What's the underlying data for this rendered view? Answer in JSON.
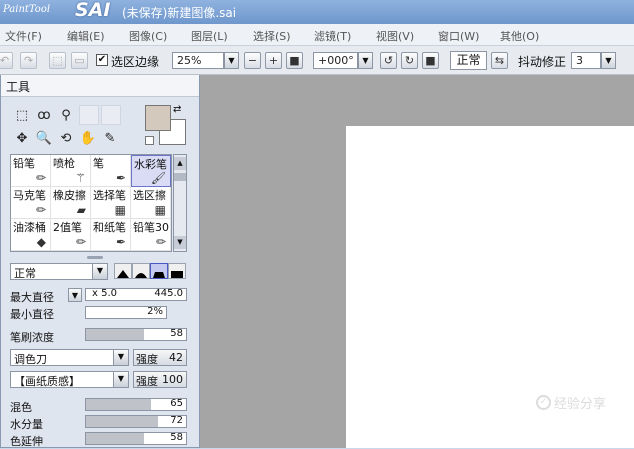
{
  "app": {
    "logo_small": "PaintTool",
    "logo_big": "SAI",
    "title": "(未保存)新建图像.sai"
  },
  "menu": [
    "文件(F)",
    "编辑(E)",
    "图像(C)",
    "图层(L)",
    "选择(S)",
    "滤镜(T)",
    "视图(V)",
    "窗口(W)",
    "其他(O)"
  ],
  "toolbar": {
    "selection_edge_checked": true,
    "selection_edge_label": "选区边缘",
    "zoom_value": "25%",
    "zoom_out": "−",
    "zoom_in": "+",
    "zoom_reset": "■",
    "rotation_value": "+000°",
    "blend_mode": "正常",
    "stabilizer_label": "抖动修正",
    "stabilizer_value": "3"
  },
  "panel": {
    "title": "工具",
    "tools_row1": [
      "⬚",
      "ꝏ",
      "⚲"
    ],
    "tools_row2": [
      "✥",
      "🔍",
      "⟲",
      "✋",
      "✎"
    ],
    "colors": {
      "primary": "#d4c9bd",
      "secondary": "#ffffff",
      "selected_brush": "#d9dcf4"
    },
    "brushes": [
      {
        "label": "铅笔",
        "icon": "✏"
      },
      {
        "label": "喷枪",
        "icon": "⚚"
      },
      {
        "label": "笔",
        "icon": "✒"
      },
      {
        "label": "水彩笔",
        "icon": "🖌"
      },
      {
        "label": "马克笔",
        "icon": "✏"
      },
      {
        "label": "橡皮擦",
        "icon": "▰"
      },
      {
        "label": "选择笔",
        "icon": "▦"
      },
      {
        "label": "选区擦",
        "icon": "▦"
      },
      {
        "label": "油漆桶",
        "icon": "◆"
      },
      {
        "label": "2值笔",
        "icon": "✏"
      },
      {
        "label": "和纸笔",
        "icon": "✒"
      },
      {
        "label": "铅笔30",
        "icon": "✏"
      }
    ],
    "mode": "正常",
    "max_size_label": "最大直径",
    "max_size_mult": "x 5.0",
    "max_size_value": "445.0",
    "min_size_label": "最小直径",
    "min_size_value": "2%",
    "density_label": "笔刷浓度",
    "density_value": 58,
    "texture1": "调色刀",
    "texture1_strength_label": "强度",
    "texture1_strength": "42",
    "texture2": "【画纸质感】",
    "texture2_strength_label": "强度",
    "texture2_strength": "100",
    "blend_label": "混色",
    "blend_value": 65,
    "water_label": "水分量",
    "water_value": 72,
    "persistence_label": "色延伸",
    "persistence_value": 58
  },
  "watermark": "经验分享"
}
